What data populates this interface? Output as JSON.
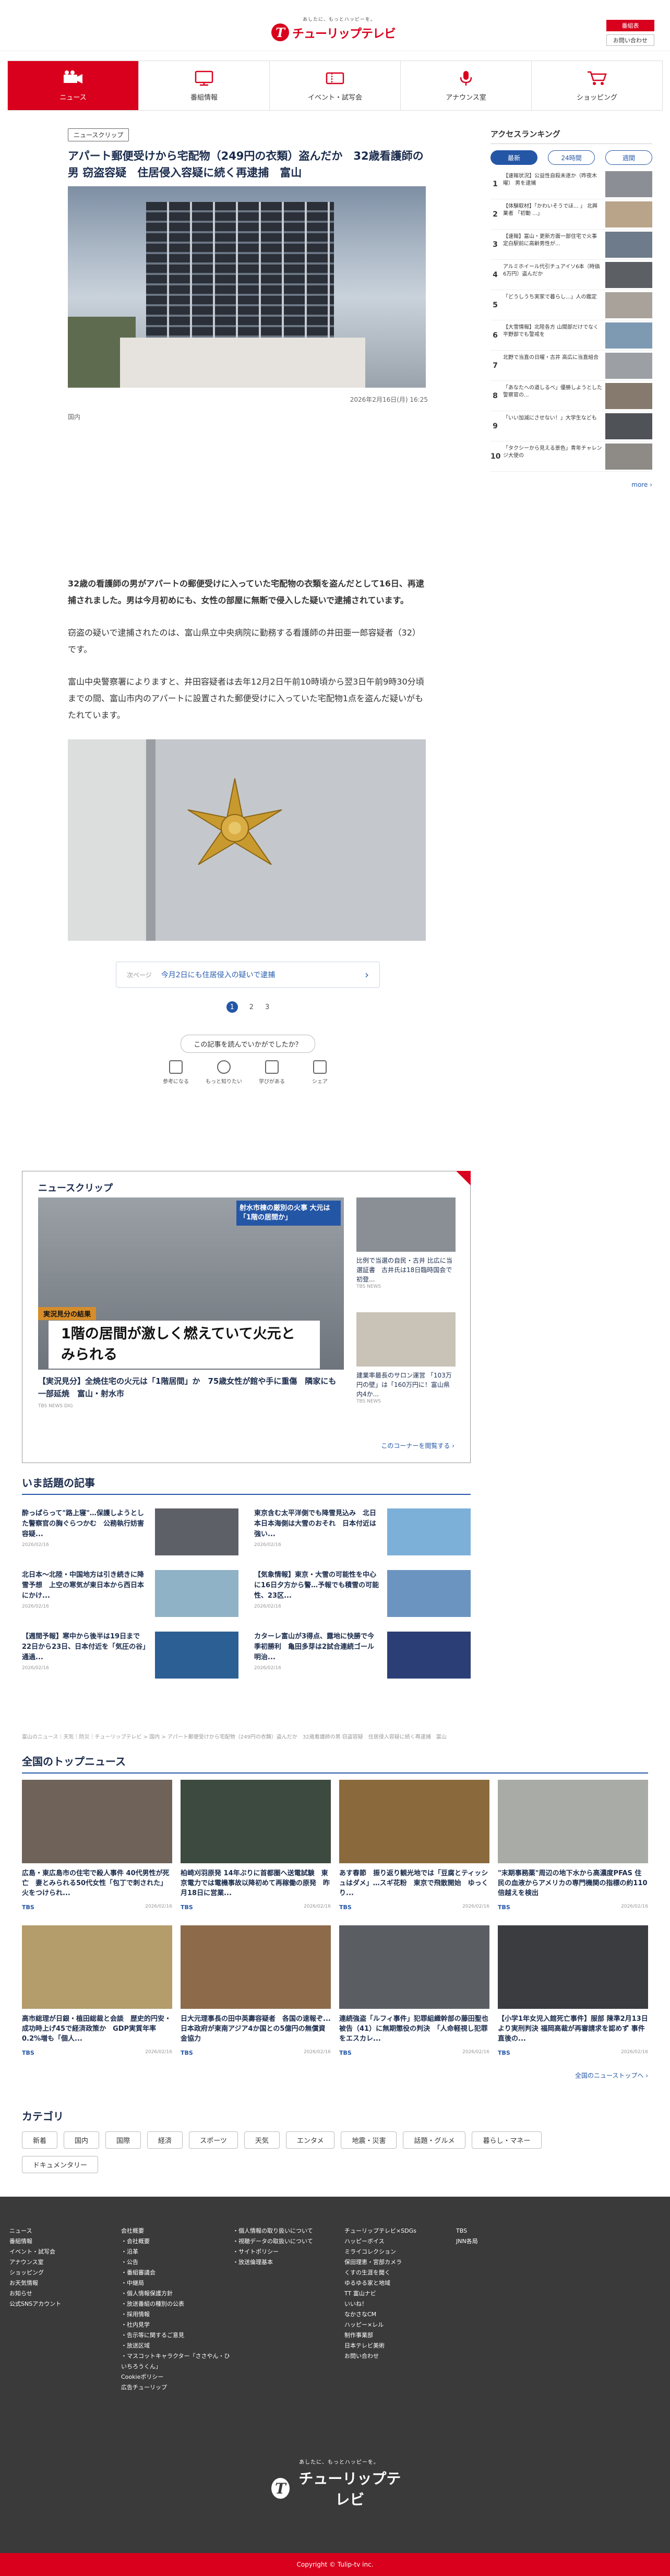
{
  "header": {
    "logo_tagline": "あしたに、もっとハッピーを。",
    "logo_name": "チューリップテレビ",
    "logo_mark": "T",
    "login_label": "番組表",
    "inquiry_label": "お問い合わせ"
  },
  "nav": [
    {
      "label": "ニュース",
      "icon": "camera-icon",
      "active": true
    },
    {
      "label": "番組情報",
      "icon": "tv-icon",
      "active": false
    },
    {
      "label": "イベント・試写会",
      "icon": "ticket-icon",
      "active": false
    },
    {
      "label": "アナウンス室",
      "icon": "mic-icon",
      "active": false
    },
    {
      "label": "ショッピング",
      "icon": "cart-icon",
      "active": false
    }
  ],
  "article": {
    "clip_tag": "ニュースクリップ",
    "title": "アパート郵便受けから宅配物（249円の衣類）盗んだか　32歳看護師の男 窃盗容疑　住居侵入容疑に続く再逮捕　富山",
    "date": "2026年2月16日(月) 16:25",
    "category": "国内",
    "paragraphs": [
      "32歳の看護師の男がアパートの郵便受けに入っていた宅配物の衣類を盗んだとして16日、再逮捕されました。男は今月初めにも、女性の部屋に無断で侵入した疑いで逮捕されています。",
      "窃盗の疑いで逮捕されたのは、富山県立中央病院に勤務する看護師の井田亜一郎容疑者（32）です。",
      "富山中央警察署によりますと、井田容疑者は去年12月2日午前10時頃から翌3日午前9時30分頃までの間、富山市内のアパートに設置された郵便受けに入っていた宅配物1点を盗んだ疑いがもたれています。"
    ],
    "next_label": "次ページ",
    "next_text": "今月2日にも住居侵入の疑いで逮捕",
    "pages": [
      "1",
      "2",
      "3"
    ],
    "reaction_question": "この記事を読んでいかがでしたか？",
    "reactions": [
      "参考になる",
      "もっと知りたい",
      "学びがある",
      "シェア"
    ]
  },
  "ranking": {
    "title": "アクセスランキング",
    "more_label": "more",
    "tabs": [
      "最新",
      "24時間",
      "週間"
    ],
    "items": [
      {
        "num": "1",
        "text": "【速報状況】公益性自殺未遂か（昨夜木曜） 男を逮捕"
      },
      {
        "num": "2",
        "text": "【体験取材】「かわいそうでほ... 」 北興業者 「初動 ...」"
      },
      {
        "num": "3",
        "text": "【速報】富山・更新方面一部住宅で火事 定白駅前に高齢男性が..."
      },
      {
        "num": "4",
        "text": "アルミホイール代引チュアイソ6本（時価6万円）盗んだか"
      },
      {
        "num": "5",
        "text": "「どうしうち実家で暮らし...」人の鑑定"
      },
      {
        "num": "6",
        "text": "【大雪情報】北陸各方 山間部だけでなく平野部でも警戒を"
      },
      {
        "num": "7",
        "text": "北野で当直の日曜・古井 高広に当直組合"
      },
      {
        "num": "8",
        "text": "「あなたへの道しるべ」優勝しようとした警察官の..."
      },
      {
        "num": "9",
        "text": "「いい加減にさせない！」大学生なども"
      },
      {
        "num": "10",
        "text": "「タクシーから見える景色」青年チャレンジ大使の"
      }
    ]
  },
  "clip_section": {
    "title": "ニュースクリップ",
    "main_caption_tag": "実況見分の結果",
    "main_caption": "1階の居間が激しく燃えていて火元とみられる",
    "main_badge": "射水市棟の厳別の火事 大元は「1階の居間か」",
    "main_text": "【実況見分】全焼住宅の火元は「1階居間」か　75歳女性が館や手に重傷　隣家にも一部延焼　富山・射水市",
    "main_source": "TBS NEWS DIG",
    "small": [
      {
        "text": "比例で当選の自民・古井 比広に当選証書　古井氏は18日臨時国会で初登...",
        "src": "TBS NEWS"
      },
      {
        "text": "建業率最長のサロン運営 「103万円の壁」は「160万円に！富山県内4か...",
        "src": "TBS NEWS"
      }
    ],
    "to_corner": "このコーナーを閲覧する"
  },
  "topics": {
    "title": "いま話題の記事",
    "items": [
      {
        "text": "酔っぱらって\"路上寝\"…保護しようとした警察官の胸ぐらつかむ　公務執行妨害容疑...",
        "src": "2026/02/16"
      },
      {
        "text": "東京含む太平洋側でも降雪見込み　北日本日本海側は大雪のおそれ　日本付近は強い...",
        "src": "2026/02/16"
      },
      {
        "text": "北日本～北陸・中国地方は引き続きに降雪予想　上空の寒気が東日本から西日本にかけ...",
        "src": "2026/02/16"
      },
      {
        "text": "【気象情報】東京・大雪の可能性を中心に16日夕方から警…予報でも積雪の可能性、23区...",
        "src": "2026/02/16"
      },
      {
        "text": "【週間予報】寒中から後半は19日まで　22日から23日、日本付近を「気圧の谷」通過...",
        "src": "2026/02/16"
      },
      {
        "text": "カターレ富山が3得点、露地に快勝で今季初勝利　亀田多芽は2試合連続ゴール　明治...",
        "src": "2026/02/16"
      }
    ]
  },
  "breadcrumb": "富山のニュース｜天気｜防災｜チューリップテレビ > 国内 > アパート郵便受けから宅配物（249円の衣類）盗んだか　32歳看護師の男 窃盗容疑　住居侵入容疑に続く再逮捕　富山",
  "topnews": {
    "title": "全国のトップニュース",
    "items": [
      {
        "text": "広島・東広島市の住宅で殺人事件 40代男性が死亡　妻とみられる50代女性「包丁で刺された」火をつけられ...",
        "src": "TBS",
        "date": "2026/02/16"
      },
      {
        "text": "柏崎刈羽原発 14年ぶりに首都圏へ送電試験　東京電力では電機事故以降初めて再稼働の原発　昨月18日に営業...",
        "src": "TBS",
        "date": "2026/02/16"
      },
      {
        "text": "あす春節　振り返り観光地では「豆腐とティッシュはダメ」…スギ花粉　東京で飛散開始　ゆっくり...",
        "src": "TBS",
        "date": "2026/02/16"
      },
      {
        "text": "\"末期事務薬\"周辺の地下水から高濃度PFAS 住民の血液からアメリカの専門機関の指標の約110倍越えを検出",
        "src": "TBS",
        "date": "2026/02/16"
      },
      {
        "text": "高市総理が日銀・植田総裁と会談　歴史的円安・成功時上げ45で経済政策か　GDP実質年率0.2%増も「個人...",
        "src": "TBS",
        "date": "2026/02/16"
      },
      {
        "text": "日大元理事長の田中英壽容疑者　各国の速報ぞ... 日本政府が東南アジア4か国との5億円の無償資金協力",
        "src": "TBS",
        "date": "2026/02/16"
      },
      {
        "text": "連続強盗「ルフィ事件」犯罪組織幹部の藤田聖也被告（41）に無期懲役の判決　「人命軽視し犯罪をエスカレ...",
        "src": "TBS",
        "date": "2026/02/16"
      },
      {
        "text": "【小学1年女児入館死亡事件】服部 陳準2月13日より実刑判決 福岡高裁が再審請求を認めず 事件直後の...",
        "src": "TBS",
        "date": "2026/02/16"
      }
    ],
    "all_label": "全国のニューストップへ"
  },
  "categories": {
    "title": "カテゴリ",
    "items": [
      "新着",
      "国内",
      "国際",
      "経済",
      "スポーツ",
      "天気",
      "エンタメ",
      "地震・災害",
      "話題・グルメ",
      "暮らし・マネー",
      "ドキュメンタリー"
    ]
  },
  "footer": {
    "cols": [
      [
        "ニュース",
        "番組情報",
        "イベント・試写会",
        "アナウンス室",
        "ショッピング",
        "お天気情報",
        "お知らせ",
        "公式SNSアカウント"
      ],
      [
        "会社概要",
        "・会社概要",
        "・沿革",
        "・公告",
        "・番組審議会",
        "・中継局",
        "・個人情報保護方針",
        "・放送番組の種別の公表",
        "・採用情報",
        "・社内見学",
        "・告示等に関するご意見",
        "・放送区域",
        "・マスコットキャラクター「ささやん・ひいちろうくん」",
        "Cookieポリシー",
        "広告チューリップ"
      ],
      [
        "・個人情報の取り扱いについて",
        "・視聴データの取扱いについて",
        "・サイトポリシー",
        "・放送倫理基本"
      ],
      [
        "チューリップテレビ×SDGs",
        "ハッピーボイス",
        "ミライコレクション",
        "保田理恵・宮部カメラ",
        "くすの生涯を聞く",
        "ゆるゆる家と地域",
        "TT 富山ナビ",
        "いいね！",
        "なかさなCM",
        "ハッピー×レル",
        "制作事業部",
        "日本テレビ美術",
        "お問い合わせ"
      ],
      [
        "TBS",
        "JNN各局"
      ]
    ],
    "logo_tagline": "あしたに、もっとハッピーを。",
    "logo_name": "チューリップテレビ",
    "copyright": "Copyright © Tulip-tv inc."
  },
  "colors": {
    "brand_red": "#d8001c",
    "accent_blue": "#2456a6",
    "navy_text": "#1a2b4c",
    "footer_bg": "#3a3a3a"
  }
}
